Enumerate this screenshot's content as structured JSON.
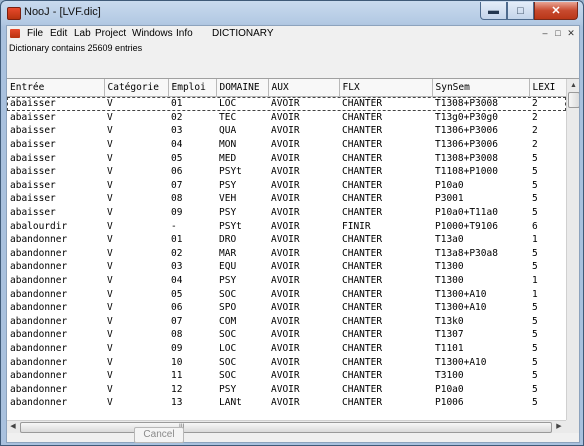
{
  "window": {
    "title": "NooJ - [LVF.dic]"
  },
  "menubar": {
    "items": [
      "File",
      "Edit",
      "Lab",
      "Project",
      "Windows",
      "Info",
      "DICTIONARY"
    ]
  },
  "status_text": "Dictionary contains 25609 entries",
  "table": {
    "columns": [
      "Entrée",
      "Catégorie",
      "Emploi",
      "DOMAINE",
      "AUX",
      "FLX",
      "SynSem",
      "LEXI"
    ],
    "rows": [
      [
        "abaisser",
        "V",
        "01",
        "LOC",
        "AVOIR",
        "CHANTER",
        "T1308+P3008",
        "2"
      ],
      [
        "abaisser",
        "V",
        "02",
        "TEC",
        "AVOIR",
        "CHANTER",
        "T13g0+P30g0",
        "2"
      ],
      [
        "abaisser",
        "V",
        "03",
        "QUA",
        "AVOIR",
        "CHANTER",
        "T1306+P3006",
        "2"
      ],
      [
        "abaisser",
        "V",
        "04",
        "MON",
        "AVOIR",
        "CHANTER",
        "T1306+P3006",
        "2"
      ],
      [
        "abaisser",
        "V",
        "05",
        "MED",
        "AVOIR",
        "CHANTER",
        "T1308+P3008",
        "5"
      ],
      [
        "abaisser",
        "V",
        "06",
        "PSYt",
        "AVOIR",
        "CHANTER",
        "T1108+P1000",
        "5"
      ],
      [
        "abaisser",
        "V",
        "07",
        "PSY",
        "AVOIR",
        "CHANTER",
        "P10a0",
        "5"
      ],
      [
        "abaisser",
        "V",
        "08",
        "VEH",
        "AVOIR",
        "CHANTER",
        "P3001",
        "5"
      ],
      [
        "abaisser",
        "V",
        "09",
        "PSY",
        "AVOIR",
        "CHANTER",
        "P10a0+T11a0",
        "5"
      ],
      [
        "abalourdir",
        "V",
        "-",
        "PSYt",
        "AVOIR",
        "FINIR",
        "P1000+T9106",
        "6"
      ],
      [
        "abandonner",
        "V",
        "01",
        "DRO",
        "AVOIR",
        "CHANTER",
        "T13a0",
        "1"
      ],
      [
        "abandonner",
        "V",
        "02",
        "MAR",
        "AVOIR",
        "CHANTER",
        "T13a8+P30a8",
        "5"
      ],
      [
        "abandonner",
        "V",
        "03",
        "EQU",
        "AVOIR",
        "CHANTER",
        "T1300",
        "5"
      ],
      [
        "abandonner",
        "V",
        "04",
        "PSY",
        "AVOIR",
        "CHANTER",
        "T1300",
        "1"
      ],
      [
        "abandonner",
        "V",
        "05",
        "SOC",
        "AVOIR",
        "CHANTER",
        "T1300+A10",
        "1"
      ],
      [
        "abandonner",
        "V",
        "06",
        "SPO",
        "AVOIR",
        "CHANTER",
        "T1300+A10",
        "5"
      ],
      [
        "abandonner",
        "V",
        "07",
        "COM",
        "AVOIR",
        "CHANTER",
        "T13k0",
        "5"
      ],
      [
        "abandonner",
        "V",
        "08",
        "SOC",
        "AVOIR",
        "CHANTER",
        "T1307",
        "5"
      ],
      [
        "abandonner",
        "V",
        "09",
        "LOC",
        "AVOIR",
        "CHANTER",
        "T1101",
        "5"
      ],
      [
        "abandonner",
        "V",
        "10",
        "SOC",
        "AVOIR",
        "CHANTER",
        "T1300+A10",
        "5"
      ],
      [
        "abandonner",
        "V",
        "11",
        "SOC",
        "AVOIR",
        "CHANTER",
        "T3100",
        "5"
      ],
      [
        "abandonner",
        "V",
        "12",
        "PSY",
        "AVOIR",
        "CHANTER",
        "P10a0",
        "5"
      ],
      [
        "abandonner",
        "V",
        "13",
        "LANt",
        "AVOIR",
        "CHANTER",
        "P1006",
        "5"
      ]
    ]
  },
  "buttons": {
    "cancel": "Cancel"
  },
  "icons": {
    "window_controls": [
      "minimize-icon",
      "maximize-icon",
      "close-icon"
    ],
    "mdi_controls": [
      "minimize-icon",
      "restore-icon",
      "close-icon"
    ]
  }
}
